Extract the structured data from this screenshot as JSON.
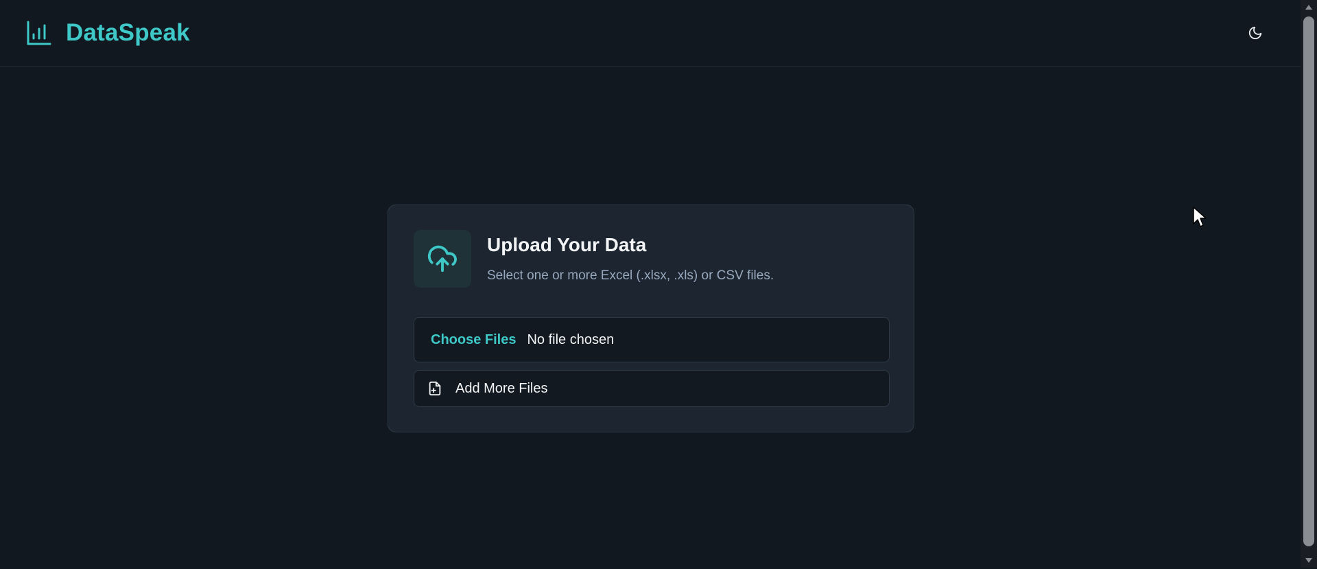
{
  "header": {
    "brand_title": "DataSpeak",
    "brand_icon": "bar-chart-icon",
    "theme_toggle_icon": "moon-icon"
  },
  "upload_card": {
    "icon": "cloud-upload-icon",
    "title": "Upload Your Data",
    "subtitle": "Select one or more Excel (.xlsx, .xls) or CSV files.",
    "choose_files_label": "Choose Files",
    "file_status": "No file chosen",
    "add_more_icon": "file-plus-icon",
    "add_more_label": "Add More Files"
  },
  "colors": {
    "background": "#121820",
    "card_background": "#1c2530",
    "accent": "#3ec9c8",
    "text_primary": "#f2f4f6",
    "text_secondary": "#98a8bd"
  }
}
